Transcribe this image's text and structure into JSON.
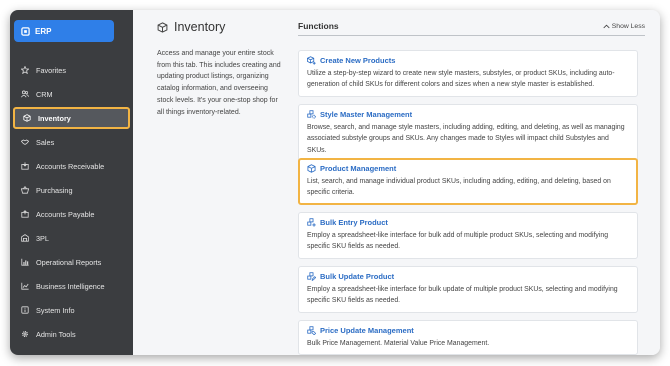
{
  "sidebar": {
    "app_button": "ERP",
    "items": [
      {
        "label": "Favorites",
        "icon": "star-icon"
      },
      {
        "label": "CRM",
        "icon": "users-icon"
      },
      {
        "label": "Inventory",
        "icon": "cube-icon",
        "active": true
      },
      {
        "label": "Sales",
        "icon": "handshake-icon"
      },
      {
        "label": "Accounts Receivable",
        "icon": "receivable-icon"
      },
      {
        "label": "Purchasing",
        "icon": "basket-icon"
      },
      {
        "label": "Accounts Payable",
        "icon": "payable-icon"
      },
      {
        "label": "3PL",
        "icon": "warehouse-icon"
      },
      {
        "label": "Operational Reports",
        "icon": "chart-icon"
      },
      {
        "label": "Business Intelligence",
        "icon": "trend-icon"
      },
      {
        "label": "System Info",
        "icon": "info-icon"
      },
      {
        "label": "Admin Tools",
        "icon": "gear-icon"
      }
    ]
  },
  "intro": {
    "title": "Inventory",
    "description": "Access and manage your entire stock from this tab. This includes creating and updating product listings, organizing catalog information, and overseeing stock levels. It's your one-stop shop for all things inventory-related."
  },
  "functions": {
    "title": "Functions",
    "toggle_label": "Show Less",
    "cards": [
      {
        "title": "Create New Products",
        "description": "Utilize a step-by-step wizard to create new style masters, substyles, or product SKUs, including auto-generation of child SKUs for different colors and sizes when a new style master is established."
      },
      {
        "title": "Style Master Management",
        "description": "Browse, search, and manage style masters, including adding, editing, and deleting, as well as managing associated substyle groups and SKUs. Any changes made to Styles will impact child Substyles and SKUs."
      },
      {
        "title": "Product Management",
        "description": "List, search, and manage individual product SKUs, including adding, editing, and deleting, based on specific criteria.",
        "active": true
      },
      {
        "title": "Bulk Entry Product",
        "description": "Employ a spreadsheet-like interface for bulk add of multiple product SKUs, selecting and modifying specific SKU fields as needed."
      },
      {
        "title": "Bulk Update Product",
        "description": "Employ a spreadsheet-like interface for bulk update of multiple product SKUs, selecting and modifying specific SKU fields as needed."
      },
      {
        "title": "Price Update Management",
        "description": "Bulk Price Management. Material Value Price Management."
      }
    ]
  },
  "colors": {
    "sidebar_bg": "#3b3d40",
    "accent_blue": "#2f7fe8",
    "highlight": "#f2b444",
    "link": "#2b6cc4"
  }
}
